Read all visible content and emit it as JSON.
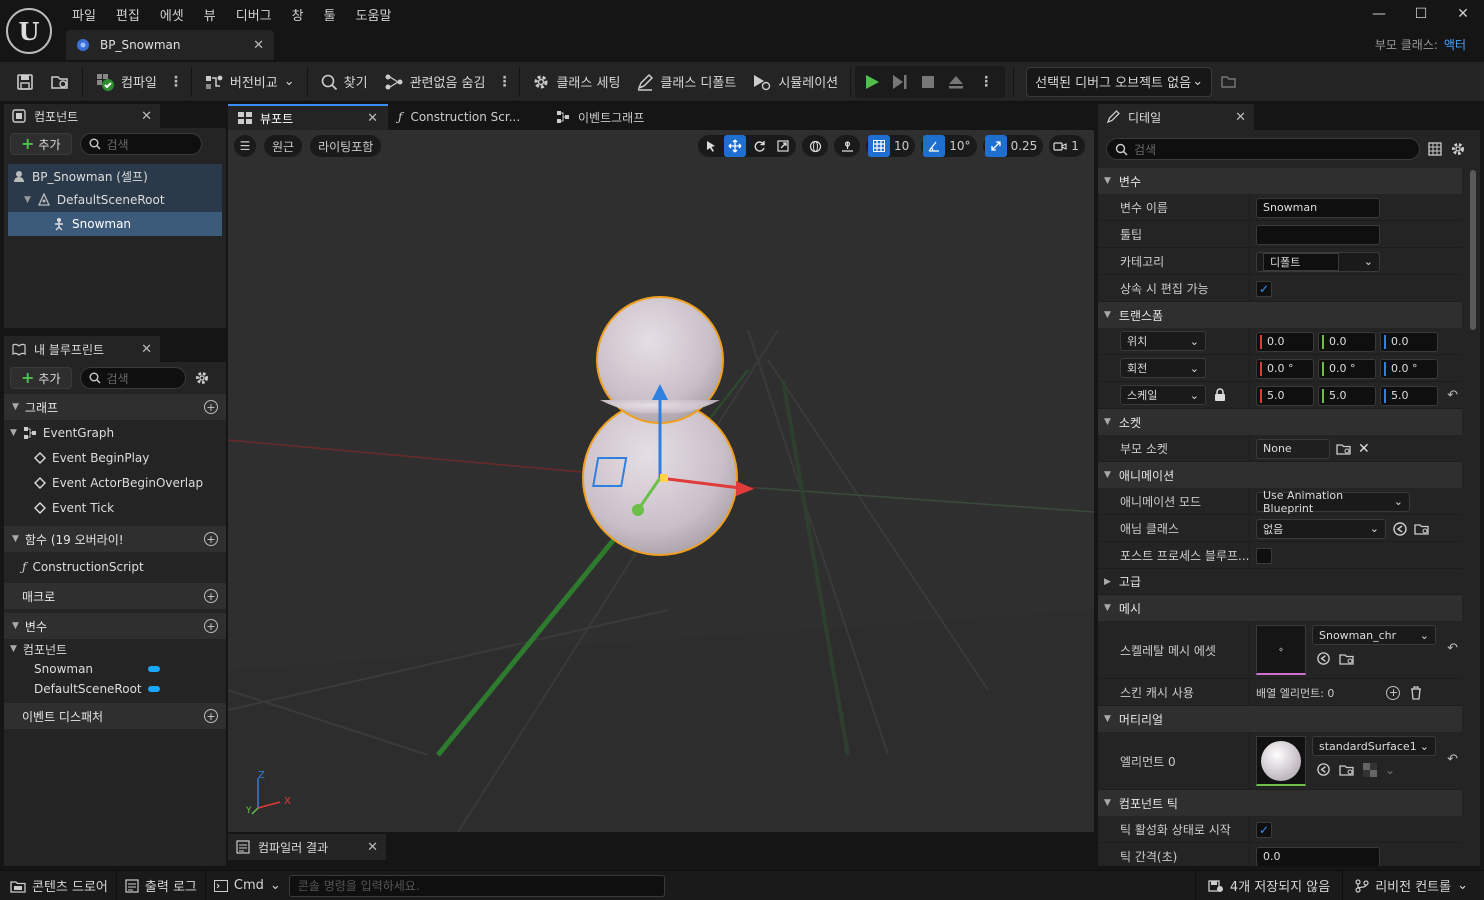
{
  "menu": [
    "파일",
    "편집",
    "에셋",
    "뷰",
    "디버그",
    "창",
    "툴",
    "도움말"
  ],
  "doc_tab": {
    "label": "BP_Snowman"
  },
  "parent_class": {
    "label": "부모 클래스:",
    "value": "액터"
  },
  "toolbar": {
    "compile": "컴파일",
    "diff": "버전비교",
    "find": "찾기",
    "hide_unrelated": "관련없음 숨김",
    "class_settings": "클래스 세팅",
    "class_defaults": "클래스 디폴트",
    "simulation": "시뮬레이션",
    "debug_object": "선택된 디버그 오브젝트 없음"
  },
  "components_panel": {
    "tab": "컴포넌트",
    "add": "추가",
    "search_placeholder": "검색",
    "tree": [
      {
        "label": "BP_Snowman (셀프)",
        "icon": "actor-icon"
      },
      {
        "label": "DefaultSceneRoot",
        "icon": "scene-root-icon"
      },
      {
        "label": "Snowman",
        "icon": "skeletal-mesh-icon",
        "selected": true
      }
    ]
  },
  "my_blueprint": {
    "tab": "내 블루프린트",
    "add": "추가",
    "search_placeholder": "검색",
    "graphs_header": "그래프",
    "event_graph": "EventGraph",
    "events": [
      "Event BeginPlay",
      "Event ActorBeginOverlap",
      "Event Tick"
    ],
    "functions_header": "함수 (19 오버라이!",
    "construction_script": "ConstructionScript",
    "macros_header": "매크로",
    "variables_header": "변수",
    "components_sub": "컴포넌트",
    "variables": [
      "Snowman",
      "DefaultSceneRoot"
    ],
    "dispatchers_header": "이벤트 디스패처"
  },
  "viewport_tabs": [
    {
      "label": "뷰포트",
      "active": true,
      "closable": true
    },
    {
      "label": "Construction Scr...",
      "active": false
    },
    {
      "label": "이벤트그래프",
      "active": false
    }
  ],
  "viewport": {
    "perspective": "원근",
    "lighting": "라이팅포함",
    "grid_snap": "10",
    "rot_snap": "10°",
    "scale_snap": "0.25",
    "camera_speed": "1",
    "axis_z": "Z",
    "axis_x": "X",
    "axis_y": "Y"
  },
  "compiler_tab": "컴파일러 결과",
  "details": {
    "tab": "디테일",
    "search_placeholder": "검색",
    "sections": {
      "variable": "변수",
      "transform": "트랜스폼",
      "sockets": "소켓",
      "animation": "애니메이션",
      "advanced": "고급",
      "mesh": "메시",
      "materials": "머티리얼",
      "component_tick": "컴포넌트 틱"
    },
    "var_name_label": "변수 이름",
    "var_name_value": "Snowman",
    "tooltip_label": "툴팁",
    "tooltip_value": "",
    "category_label": "카테고리",
    "category_value": "디폴트",
    "editable_inherit_label": "상속 시 편집 가능",
    "location_label": "위치",
    "location": [
      "0.0",
      "0.0",
      "0.0"
    ],
    "rotation_label": "회전",
    "rotation": [
      "0.0 °",
      "0.0 °",
      "0.0 °"
    ],
    "scale_label": "스케일",
    "scale": [
      "5.0",
      "5.0",
      "5.0"
    ],
    "parent_socket_label": "부모 소켓",
    "parent_socket_value": "None",
    "anim_mode_label": "애니메이션 모드",
    "anim_mode_value": "Use Animation Blueprint",
    "anim_class_label": "애님 클래스",
    "anim_class_value": "없음",
    "post_process_label": "포스트 프로세스 블루프...",
    "skeletal_mesh_label": "스켈레탈 메시 에셋",
    "skeletal_mesh_value": "Snowman_chr",
    "skin_cache_label": "스킨 캐시 사용",
    "skin_cache_value": "배열 엘리먼트: 0",
    "element0_label": "엘리먼트 0",
    "element0_value": "standardSurface1",
    "tick_start_label": "틱 활성화 상태로 시작",
    "tick_interval_label": "틱 간격(초)",
    "tick_interval_value": "0.0"
  },
  "statusbar": {
    "content_drawer": "콘텐츠 드로어",
    "output_log": "출력 로그",
    "cmd": "Cmd",
    "console_placeholder": "콘솔 명령을 입력하세요.",
    "unsaved": "4개 저장되지 않음",
    "revision_control": "리비전 컨트롤"
  },
  "colors": {
    "accent": "#3a8fff",
    "selection": "#3c5a7a",
    "play_green": "#4cc24c",
    "axis_x": "#e03a3a",
    "axis_y": "#6cc04a",
    "axis_z": "#2f7fe0",
    "outline": "#f0a020"
  }
}
